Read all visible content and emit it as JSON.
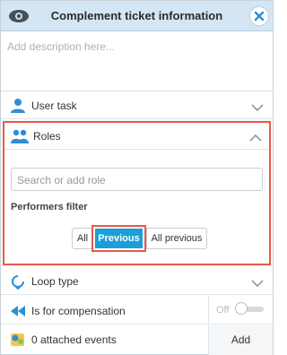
{
  "header": {
    "title": "Complement ticket information",
    "left_icon": "eye-icon",
    "close_icon": "close-icon",
    "bg_color": "#d4e6f4"
  },
  "description": {
    "placeholder": "Add description here..."
  },
  "rows": {
    "user_task": {
      "label": "User task",
      "icon": "user-icon"
    },
    "roles": {
      "label": "Roles",
      "icon": "users-icon",
      "search_placeholder": "Search or add role",
      "performers_filter_label": "Performers filter",
      "filter_options": [
        "All",
        "Previous",
        "All previous"
      ],
      "selected_filter": "Previous"
    },
    "loop_type": {
      "label": "Loop type",
      "icon": "loop-icon"
    },
    "compensation": {
      "label": "Is for compensation",
      "icon": "rewind-icon",
      "toggle_label": "Off"
    },
    "events": {
      "label": "0 attached events",
      "icon": "events-icon",
      "add_label": "Add"
    }
  },
  "colors": {
    "accent": "#1aa0d8",
    "highlight": "#e8594a"
  }
}
